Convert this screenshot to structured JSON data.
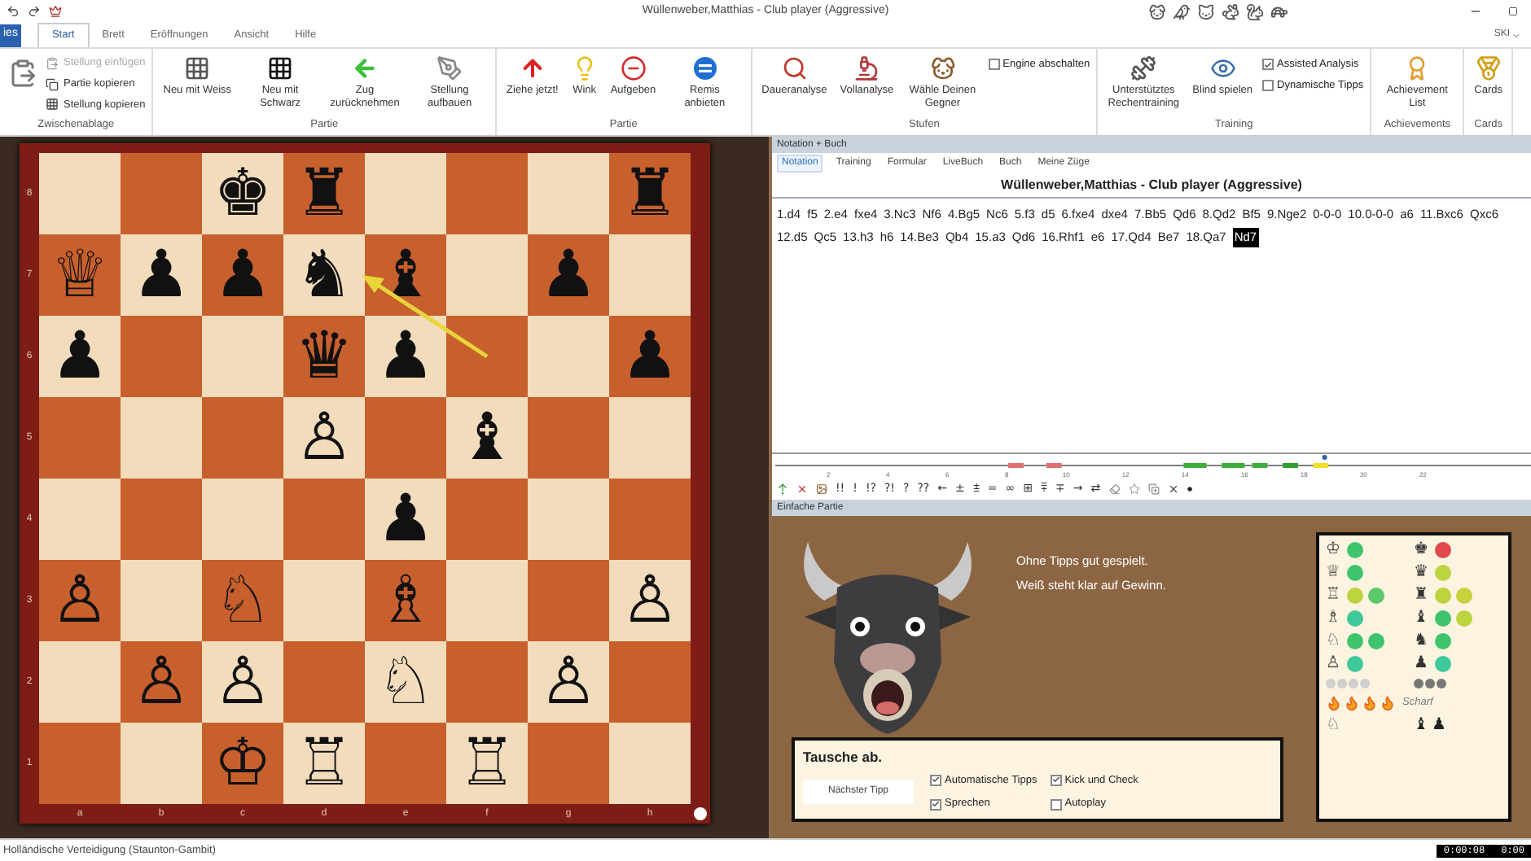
{
  "title_bar": {
    "title": "Wüllenweber,Matthias - Club player (Aggressive)"
  },
  "ribbon_tabs": [
    {
      "label": "ies",
      "kind": "file",
      "selected": false
    },
    {
      "label": "Start",
      "kind": "tab",
      "selected": true
    },
    {
      "label": "Brett",
      "kind": "tab",
      "selected": false
    },
    {
      "label": "Eröffnungen",
      "kind": "tab",
      "selected": false
    },
    {
      "label": "Ansicht",
      "kind": "tab",
      "selected": false
    },
    {
      "label": "Hilfe",
      "kind": "tab",
      "selected": false
    }
  ],
  "user": "SKI",
  "ribbon_groups": [
    {
      "label": "Zwischenablage",
      "items": [
        {
          "kind": "icon-only"
        },
        {
          "kind": "small",
          "label": "Stellung einfügen",
          "disabled": true
        },
        {
          "kind": "small",
          "label": "Partie kopieren",
          "disabled": false
        },
        {
          "kind": "small",
          "label": "Stellung kopieren",
          "disabled": false
        }
      ]
    },
    {
      "label": "Partie",
      "items": [
        {
          "kind": "large",
          "label": "Neu mit Weiss"
        },
        {
          "kind": "large",
          "label": "Neu mit Schwarz"
        },
        {
          "kind": "large",
          "label": "Zug zurücknehmen"
        },
        {
          "kind": "large",
          "label": "Stellung aufbauen"
        }
      ]
    },
    {
      "label": "Partie",
      "items": [
        {
          "kind": "large",
          "label": "Ziehe jetzt!"
        },
        {
          "kind": "large",
          "label": "Wink"
        },
        {
          "kind": "large",
          "label": "Aufgeben"
        },
        {
          "kind": "large",
          "label": "Remis anbieten"
        }
      ]
    },
    {
      "label": "Stufen",
      "items": [
        {
          "kind": "large",
          "label": "Daueranalyse"
        },
        {
          "kind": "large",
          "label": "Vollanalyse"
        },
        {
          "kind": "large",
          "label": "Wähle Deinen Gegner"
        },
        {
          "kind": "check",
          "label": "Engine abschalten",
          "checked": false
        }
      ]
    },
    {
      "label": "Training",
      "items": [
        {
          "kind": "large",
          "label": "Unterstütztes Rechentraining"
        },
        {
          "kind": "large",
          "label": "Blind spielen"
        },
        {
          "kind": "check",
          "label": "Assisted Analysis",
          "checked": true
        },
        {
          "kind": "check",
          "label": "Dynamische Tipps",
          "checked": false
        }
      ]
    },
    {
      "label": "Achievements",
      "items": [
        {
          "kind": "large",
          "label": "Achievement List"
        }
      ]
    },
    {
      "label": "Cards",
      "items": [
        {
          "kind": "large",
          "label": "Cards"
        }
      ]
    }
  ],
  "board": {
    "ranks": [
      {
        "label": "8",
        "squares": [
          {
            "kind": "empty"
          },
          {
            "kind": "empty"
          },
          {
            "kind": "piece",
            "glyph": "♚"
          },
          {
            "kind": "piece",
            "glyph": "♜"
          },
          {
            "kind": "empty"
          },
          {
            "kind": "empty"
          },
          {
            "kind": "empty"
          },
          {
            "kind": "piece",
            "glyph": "♜"
          }
        ]
      },
      {
        "label": "7",
        "squares": [
          {
            "kind": "piece",
            "glyph": "♕"
          },
          {
            "kind": "piece",
            "glyph": "♟"
          },
          {
            "kind": "piece",
            "glyph": "♟"
          },
          {
            "kind": "piece",
            "glyph": "♞"
          },
          {
            "kind": "piece",
            "glyph": "♝"
          },
          {
            "kind": "empty"
          },
          {
            "kind": "piece",
            "glyph": "♟"
          },
          {
            "kind": "empty"
          }
        ]
      },
      {
        "label": "6",
        "squares": [
          {
            "kind": "piece",
            "glyph": "♟"
          },
          {
            "kind": "empty"
          },
          {
            "kind": "empty"
          },
          {
            "kind": "piece",
            "glyph": "♛"
          },
          {
            "kind": "piece",
            "glyph": "♟"
          },
          {
            "kind": "empty"
          },
          {
            "kind": "empty"
          },
          {
            "kind": "piece",
            "glyph": "♟"
          }
        ]
      },
      {
        "label": "5",
        "squares": [
          {
            "kind": "empty"
          },
          {
            "kind": "empty"
          },
          {
            "kind": "empty"
          },
          {
            "kind": "piece",
            "glyph": "♙"
          },
          {
            "kind": "empty"
          },
          {
            "kind": "piece",
            "glyph": "♝"
          },
          {
            "kind": "empty"
          },
          {
            "kind": "empty"
          }
        ]
      },
      {
        "label": "4",
        "squares": [
          {
            "kind": "empty"
          },
          {
            "kind": "empty"
          },
          {
            "kind": "empty"
          },
          {
            "kind": "empty"
          },
          {
            "kind": "piece",
            "glyph": "♟"
          },
          {
            "kind": "empty"
          },
          {
            "kind": "empty"
          },
          {
            "kind": "empty"
          }
        ]
      },
      {
        "label": "3",
        "squares": [
          {
            "kind": "piece",
            "glyph": "♙"
          },
          {
            "kind": "empty"
          },
          {
            "kind": "piece",
            "glyph": "♘"
          },
          {
            "kind": "empty"
          },
          {
            "kind": "piece",
            "glyph": "♗"
          },
          {
            "kind": "empty"
          },
          {
            "kind": "empty"
          },
          {
            "kind": "piece",
            "glyph": "♙"
          }
        ]
      },
      {
        "label": "2",
        "squares": [
          {
            "kind": "empty"
          },
          {
            "kind": "piece",
            "glyph": "♙"
          },
          {
            "kind": "piece",
            "glyph": "♙"
          },
          {
            "kind": "empty"
          },
          {
            "kind": "piece",
            "glyph": "♘"
          },
          {
            "kind": "empty"
          },
          {
            "kind": "piece",
            "glyph": "♙"
          },
          {
            "kind": "empty"
          }
        ]
      },
      {
        "label": "1",
        "squares": [
          {
            "kind": "empty"
          },
          {
            "kind": "empty"
          },
          {
            "kind": "piece",
            "glyph": "♔"
          },
          {
            "kind": "piece",
            "glyph": "♖"
          },
          {
            "kind": "empty"
          },
          {
            "kind": "piece",
            "glyph": "♖"
          },
          {
            "kind": "empty"
          },
          {
            "kind": "empty"
          }
        ]
      }
    ],
    "files": [
      "a",
      "b",
      "c",
      "d",
      "e",
      "f",
      "g",
      "h"
    ],
    "last_move_arrow": true,
    "white_to_move": true
  },
  "notation_panel": {
    "header": "Notation + Buch",
    "tabs": [
      {
        "label": "Notation",
        "selected": true
      },
      {
        "label": "Training",
        "selected": false
      },
      {
        "label": "Formular",
        "selected": false
      },
      {
        "label": "LiveBuch",
        "selected": false
      },
      {
        "label": "Buch",
        "selected": false
      },
      {
        "label": "Meine Züge",
        "selected": false
      }
    ],
    "game_title": "Wüllenweber,Matthias - Club player (Aggressive)",
    "moves": [
      {
        "text": "1.d4",
        "selected": false
      },
      {
        "text": "f5",
        "selected": false
      },
      {
        "text": "2.e4",
        "selected": false
      },
      {
        "text": "fxe4",
        "selected": false
      },
      {
        "text": "3.Nc3",
        "selected": false
      },
      {
        "text": "Nf6",
        "selected": false
      },
      {
        "text": "4.Bg5",
        "selected": false
      },
      {
        "text": "Nc6",
        "selected": false
      },
      {
        "text": "5.f3",
        "selected": false
      },
      {
        "text": "d5",
        "selected": false
      },
      {
        "text": "6.fxe4",
        "selected": false
      },
      {
        "text": "dxe4",
        "selected": false
      },
      {
        "text": "7.Bb5",
        "selected": false
      },
      {
        "text": "Qd6",
        "selected": false
      },
      {
        "text": "8.Qd2",
        "selected": false
      },
      {
        "text": "Bf5",
        "selected": false
      },
      {
        "text": "9.Nge2",
        "selected": false
      },
      {
        "text": "0-0-0",
        "selected": false
      },
      {
        "text": "10.0-0-0",
        "selected": false
      },
      {
        "text": "a6",
        "selected": false
      },
      {
        "text": "11.Bxc6",
        "selected": false
      },
      {
        "text": "Qxc6",
        "selected": false
      },
      {
        "text": "12.d5",
        "selected": false
      },
      {
        "text": "Qc5",
        "selected": false
      },
      {
        "text": "13.h3",
        "selected": false
      },
      {
        "text": "h6",
        "selected": false
      },
      {
        "text": "14.Be3",
        "selected": false
      },
      {
        "text": "Qb4",
        "selected": false
      },
      {
        "text": "15.a3",
        "selected": false
      },
      {
        "text": "Qd6",
        "selected": false
      },
      {
        "text": "16.Rhf1",
        "selected": false
      },
      {
        "text": "e6",
        "selected": false
      },
      {
        "text": "17.Qd4",
        "selected": false
      },
      {
        "text": "Be7",
        "selected": false
      },
      {
        "text": "18.Qa7",
        "selected": false
      },
      {
        "text": "Nd7",
        "selected": true
      }
    ],
    "timeline_ticks": [
      "2",
      "4",
      "6",
      "8",
      "10",
      "12",
      "14",
      "16",
      "18",
      "20",
      "22"
    ],
    "symbols": [
      "!!",
      "!",
      "!?",
      "?!",
      "?",
      "??",
      "←",
      "±",
      "⩲",
      "=",
      "∞",
      "⊞",
      "⩱",
      "∓",
      "→",
      "⇄"
    ]
  },
  "game_panel": {
    "header": "Einfache Partie",
    "comment": [
      "Ohne Tipps gut gespielt.",
      "Weiß steht klar auf Gewinn."
    ],
    "tip": "Tausche ab.",
    "next_tip_button": "Nächster Tipp",
    "options": [
      {
        "label": "Automatische Tipps",
        "checked": true
      },
      {
        "label": "Kick und Check",
        "checked": true
      },
      {
        "label": "Sprechen",
        "checked": true
      },
      {
        "label": "Autoplay",
        "checked": false
      }
    ],
    "material": [
      {
        "white": {
          "glyph": "♔",
          "dots": [
            {
              "color": "#3ec46d"
            }
          ]
        },
        "black": {
          "glyph": "♚",
          "dots": [
            {
              "color": "#e0484b"
            }
          ]
        }
      },
      {
        "white": {
          "glyph": "♕",
          "dots": [
            {
              "color": "#3ec46d"
            }
          ]
        },
        "black": {
          "glyph": "♛",
          "dots": [
            {
              "color": "#bdd43e"
            }
          ]
        }
      },
      {
        "white": {
          "glyph": "♖",
          "dots": [
            {
              "color": "#bdd43e"
            },
            {
              "color": "#5cc96a"
            }
          ]
        },
        "black": {
          "glyph": "♜",
          "dots": [
            {
              "color": "#bdd43e"
            },
            {
              "color": "#c7d23f"
            }
          ]
        }
      },
      {
        "white": {
          "glyph": "♗",
          "dots": [
            {
              "color": "#3ec99a"
            }
          ]
        },
        "black": {
          "glyph": "♝",
          "dots": [
            {
              "color": "#3ec46d"
            },
            {
              "color": "#bdd43e"
            }
          ]
        }
      },
      {
        "white": {
          "glyph": "♘",
          "dots": [
            {
              "color": "#3ec46d"
            },
            {
              "color": "#3ec46d"
            }
          ]
        },
        "black": {
          "glyph": "♞",
          "dots": [
            {
              "color": "#3ec46d"
            }
          ]
        }
      },
      {
        "white": {
          "glyph": "♙",
          "dots": [
            {
              "color": "#3ec99a"
            }
          ]
        },
        "black": {
          "glyph": "♟",
          "dots": [
            {
              "color": "#3ec99a"
            }
          ]
        }
      }
    ],
    "spare_white": [
      {
        "color": "#cfcfcf"
      },
      {
        "color": "#cfcfcf"
      },
      {
        "color": "#cfcfcf"
      },
      {
        "color": "#cfcfcf"
      }
    ],
    "spare_black": [
      {
        "color": "#777777"
      },
      {
        "color": "#777777"
      },
      {
        "color": "#777777"
      }
    ],
    "sharpness": {
      "stars": 4,
      "label": "Scharf"
    },
    "captured_white": [
      "♘"
    ],
    "captured_black": [
      "♝",
      "♟"
    ]
  },
  "status_bar": {
    "opening": "Holländische Verteidigung (Staunton-Gambit)",
    "clocks": [
      "0:00:08",
      "0:00"
    ]
  }
}
